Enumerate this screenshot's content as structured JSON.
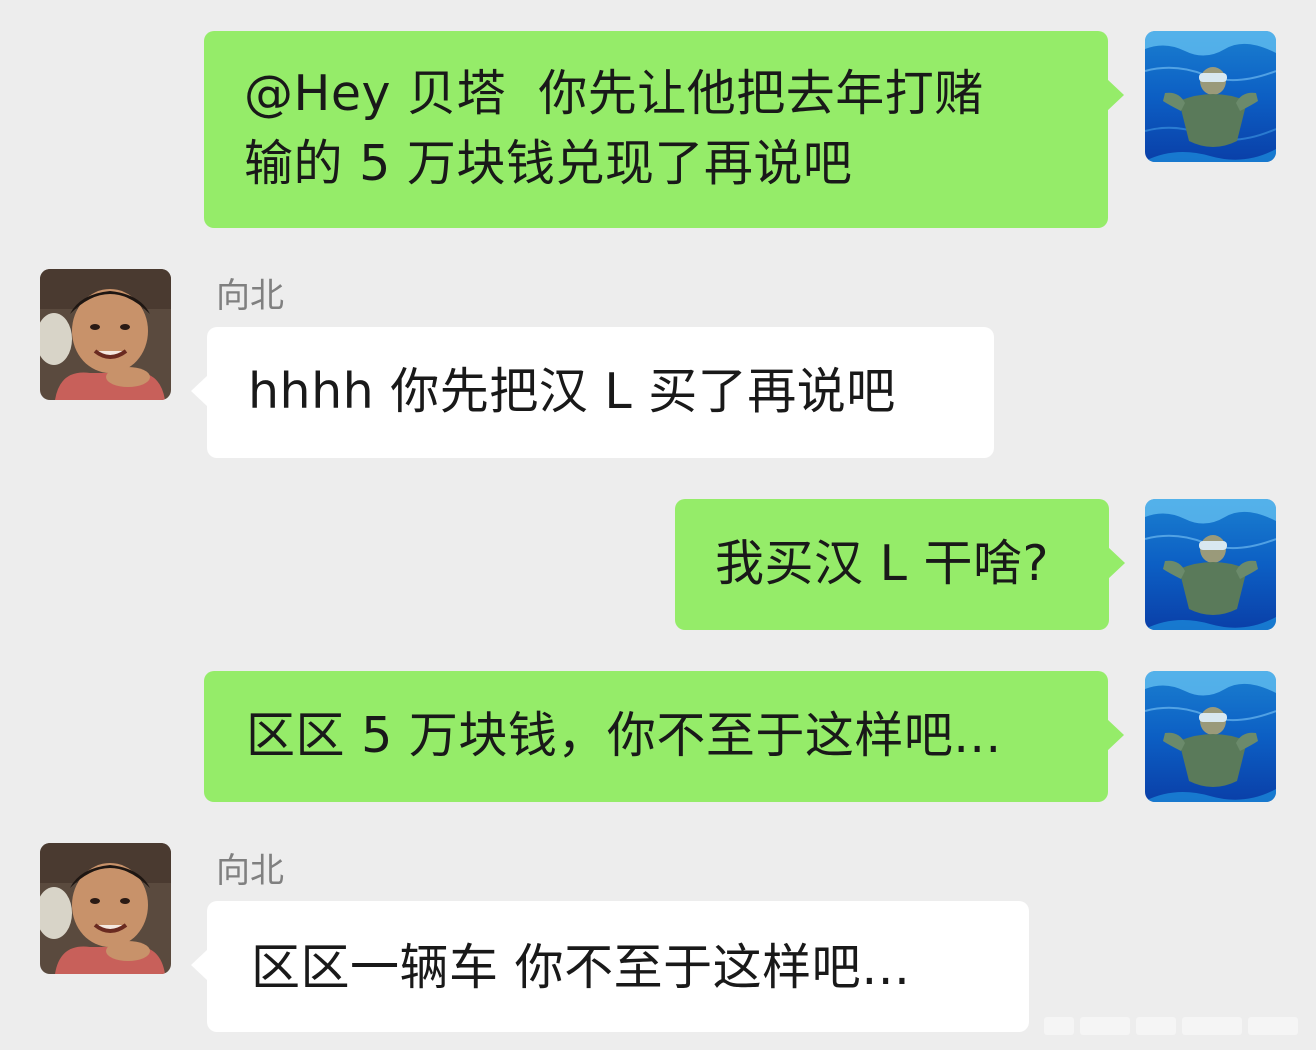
{
  "messages": [
    {
      "side": "me",
      "text": "@Hey 贝塔  你先让他把去年打赌\n输的 5 万块钱兑现了再说吧"
    },
    {
      "side": "them",
      "sender": "向北",
      "text": "hhhh 你先把汉 L 买了再说吧"
    },
    {
      "side": "me",
      "text": "我买汉 L 干啥?"
    },
    {
      "side": "me",
      "text": "区区 5 万块钱，你不至于这样吧..."
    },
    {
      "side": "them",
      "sender": "向北",
      "text": "区区一辆车 你不至于这样吧…"
    }
  ],
  "colors": {
    "background": "#ededed",
    "my_bubble": "#95ec69",
    "their_bubble": "#ffffff",
    "sender_name": "#808080",
    "text": "#191919"
  },
  "avatars": {
    "me": "swimmer-underwater-avatar",
    "them": "smiling-boy-photo-avatar"
  }
}
